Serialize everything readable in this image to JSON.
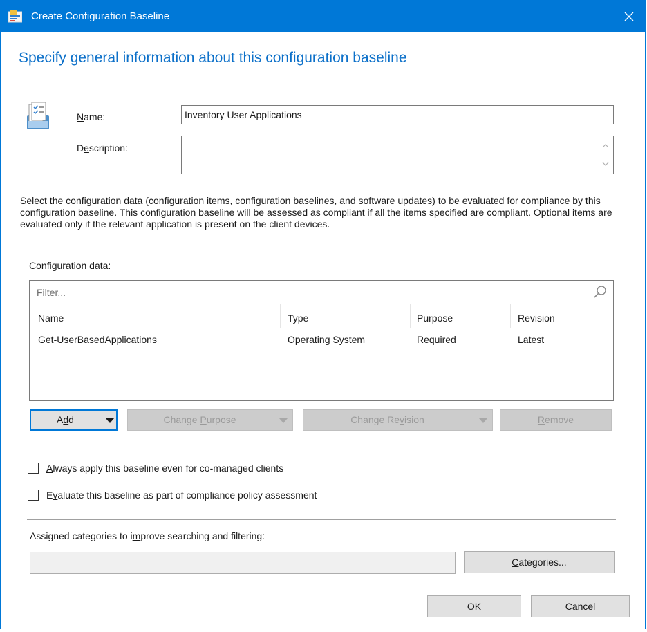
{
  "window": {
    "title": "Create Configuration Baseline",
    "title_icon": "baseline-app-icon",
    "close_icon": "close-icon"
  },
  "page": {
    "heading": "Specify general information about this configuration baseline"
  },
  "form": {
    "name_label_accel": "N",
    "name_label_rest": "ame:",
    "name_value": "Inventory User Applications",
    "description_label_pre": "D",
    "description_label_accel": "e",
    "description_label_rest": "scription:",
    "description_value": ""
  },
  "instructions": "Select the configuration data (configuration items, configuration baselines, and software updates) to be evaluated for compliance by this configuration baseline. This configuration baseline will be assessed as compliant if all the items specified are compliant. Optional items are evaluated only if the relevant application is present on  the client devices.",
  "config_data": {
    "label_accel": "C",
    "label_rest": "onfiguration data:",
    "filter_placeholder": "Filter...",
    "columns": [
      "Name",
      "Type",
      "Purpose",
      "Revision"
    ],
    "rows": [
      [
        "Get-UserBasedApplications",
        "Operating System",
        "Required",
        "Latest"
      ]
    ]
  },
  "buttons": {
    "add_pre": "A",
    "add_accel": "d",
    "add_rest": "d",
    "change_purpose_pre": "Change ",
    "change_purpose_accel": "P",
    "change_purpose_rest": "urpose",
    "change_revision_pre": "Change Re",
    "change_revision_accel": "v",
    "change_revision_rest": "ision",
    "remove_accel": "R",
    "remove_rest": "emove",
    "categories_accel": "C",
    "categories_rest": "ategories...",
    "ok": "OK",
    "cancel": "Cancel"
  },
  "options": {
    "always_apply_accel": "A",
    "always_apply_rest": "lways apply this baseline even for co-managed clients",
    "always_apply_checked": false,
    "evaluate_pre": "E",
    "evaluate_accel": "v",
    "evaluate_rest": "aluate this baseline as part of compliance policy assessment",
    "evaluate_checked": false
  },
  "categories": {
    "label_pre": "Assigned categories to i",
    "label_accel": "m",
    "label_rest": "prove searching and filtering:",
    "value": ""
  },
  "colors": {
    "accent": "#0078d7",
    "heading": "#0c70c9",
    "disabled_text": "#9a9a9a"
  }
}
